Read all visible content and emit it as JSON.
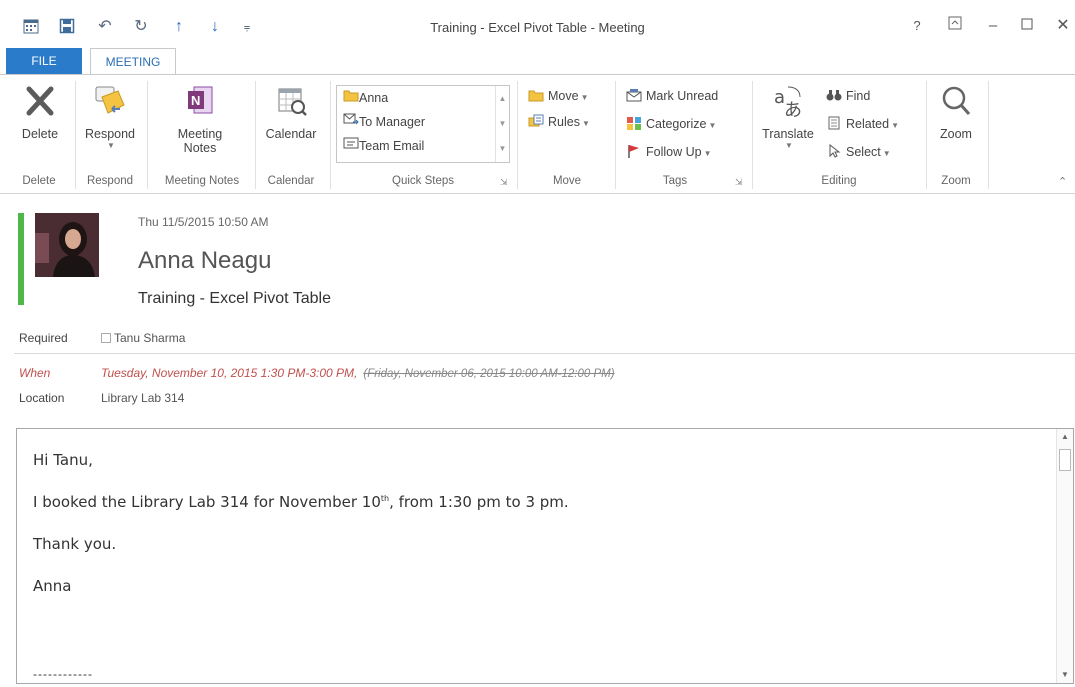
{
  "window": {
    "title": "Training - Excel Pivot Table - Meeting"
  },
  "tabs": {
    "file": "FILE",
    "meeting": "MEETING"
  },
  "ribbon": {
    "delete": {
      "label": "Delete",
      "group": "Delete"
    },
    "respond": {
      "label": "Respond",
      "group": "Respond"
    },
    "meeting_notes": {
      "label_line1": "Meeting",
      "label_line2": "Notes",
      "group": "Meeting Notes"
    },
    "calendar": {
      "label": "Calendar",
      "group": "Calendar"
    },
    "quick_steps": {
      "items": [
        "Anna",
        "To Manager",
        "Team Email"
      ],
      "group": "Quick Steps"
    },
    "move": {
      "move": "Move",
      "rules": "Rules",
      "group": "Move"
    },
    "tags": {
      "mark_unread": "Mark Unread",
      "categorize": "Categorize",
      "follow_up": "Follow Up",
      "group": "Tags"
    },
    "editing": {
      "translate": "Translate",
      "find": "Find",
      "related": "Related",
      "select": "Select",
      "group": "Editing"
    },
    "zoom": {
      "label": "Zoom",
      "group": "Zoom"
    }
  },
  "meeting": {
    "date": "Thu 11/5/2015 10:50 AM",
    "sender": "Anna Neagu",
    "subject": "Training - Excel Pivot Table",
    "required_label": "Required",
    "required_value": "Tanu Sharma",
    "when_label": "When",
    "when_new": "Tuesday, November 10, 2015 1:30 PM-3:00 PM,",
    "when_old": "(Friday, November 06, 2015 10:00 AM-12:00 PM)",
    "location_label": "Location",
    "location_value": "Library Lab 314"
  },
  "body": {
    "greeting": "Hi Tanu,",
    "line1_before": "I booked the Library Lab 314 for November 10",
    "line1_sup": "th",
    "line1_after": ", from 1:30 pm to 3 pm.",
    "thanks": "Thank you.",
    "signature": "Anna",
    "dashes": "------------"
  },
  "colors": {
    "file_tab": "#2b7bcb",
    "accent_green": "#4db848",
    "when_red": "#c0504d"
  },
  "icons": {
    "qat": [
      "calendar-app-icon",
      "save-icon",
      "undo-icon",
      "redo-icon",
      "previous-item-icon",
      "next-item-icon",
      "customize-qat-icon"
    ],
    "window": [
      "help-icon",
      "ribbon-display-icon",
      "minimize-icon",
      "maximize-icon",
      "close-icon"
    ]
  }
}
